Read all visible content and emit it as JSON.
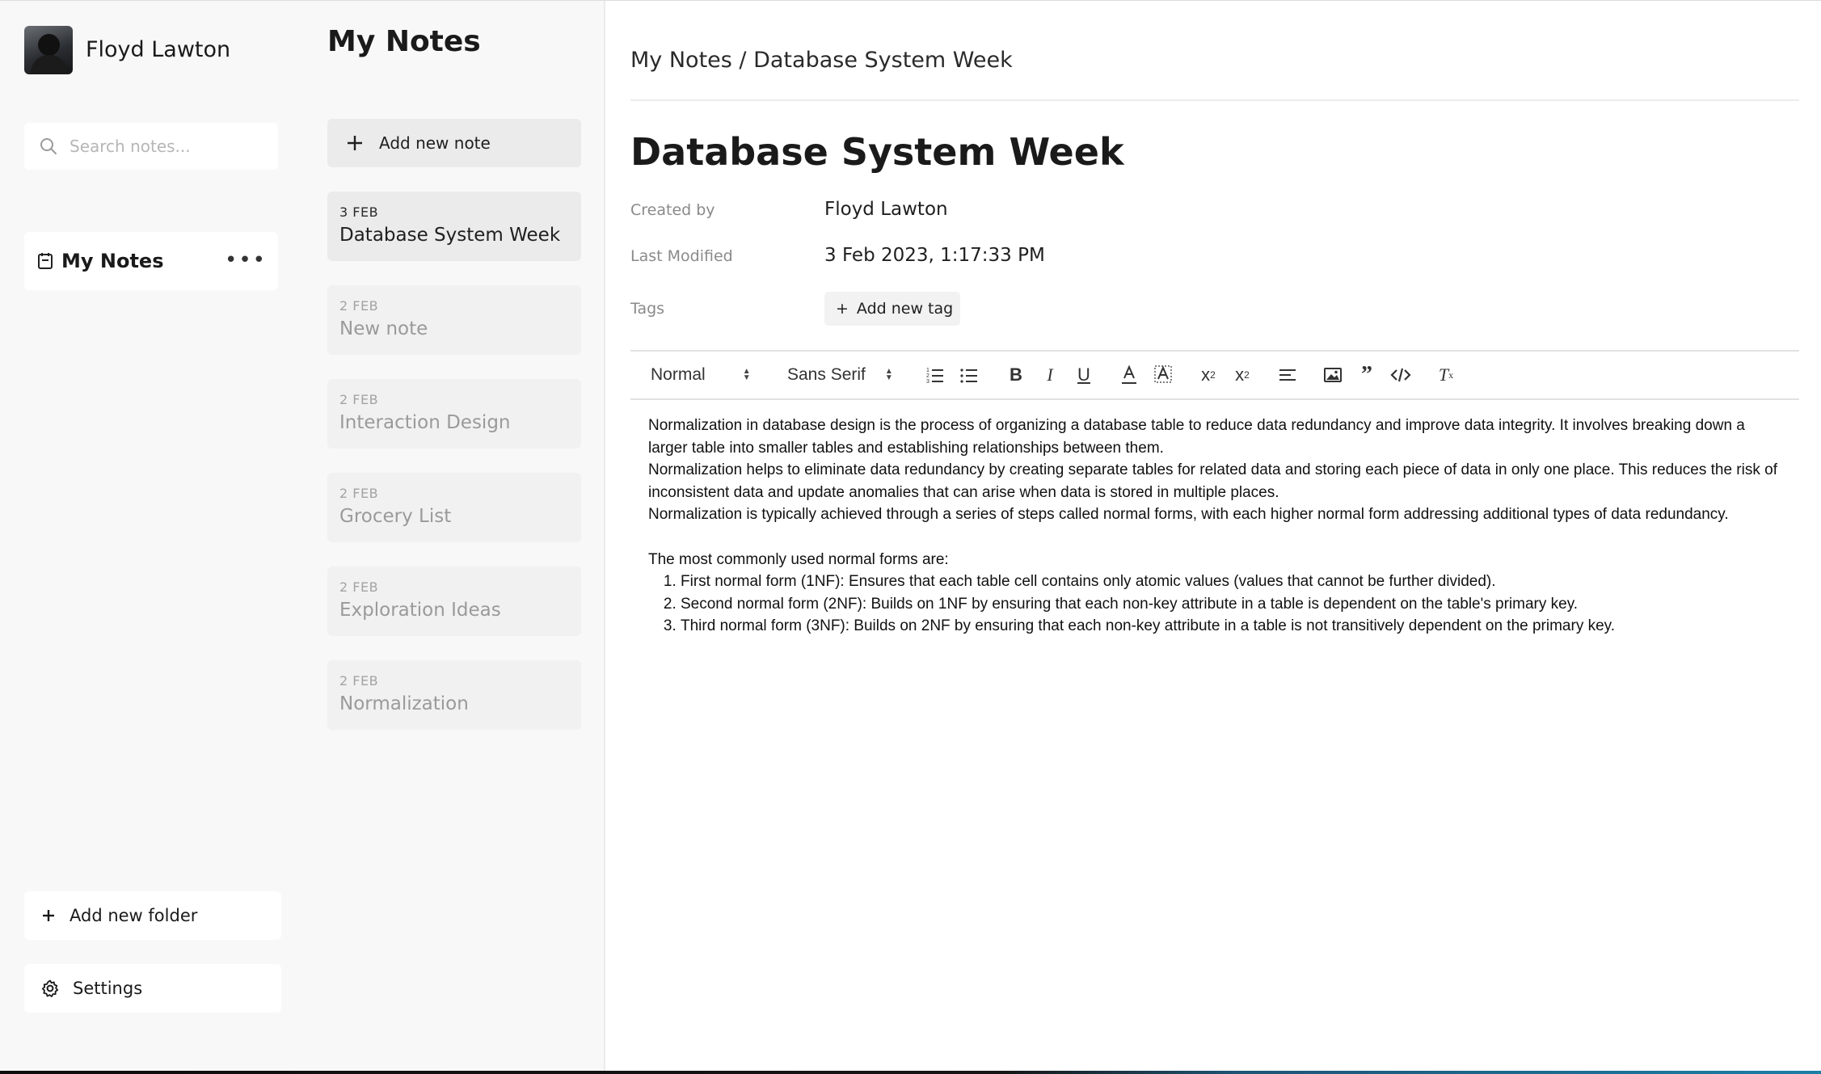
{
  "user": {
    "name": "Floyd Lawton",
    "avatar_icon": "user-avatar"
  },
  "search": {
    "placeholder": "Search notes..."
  },
  "folders": [
    {
      "label": "My Notes",
      "icon": "notebook-icon"
    }
  ],
  "sidebar_actions": {
    "add_folder": "Add new folder",
    "settings": "Settings"
  },
  "notes_panel": {
    "title": "My Notes",
    "add_note": "Add new note",
    "notes": [
      {
        "date": "3 FEB",
        "title": "Database System Week",
        "active": true
      },
      {
        "date": "2 FEB",
        "title": "New note",
        "active": false
      },
      {
        "date": "2 FEB",
        "title": "Interaction Design",
        "active": false
      },
      {
        "date": "2 FEB",
        "title": "Grocery List",
        "active": false
      },
      {
        "date": "2 FEB",
        "title": "Exploration Ideas",
        "active": false
      },
      {
        "date": "2 FEB",
        "title": "Normalization",
        "active": false
      }
    ]
  },
  "document": {
    "breadcrumb": "My Notes / Database System Week",
    "title": "Database System Week",
    "meta": {
      "created_by_label": "Created by",
      "created_by": "Floyd Lawton",
      "modified_label": "Last Modified",
      "modified": "3 Feb 2023, 1:17:33 PM",
      "tags_label": "Tags",
      "add_tag": "Add new tag"
    },
    "toolbar": {
      "heading": "Normal",
      "font": "Sans Serif",
      "icons": [
        "ordered-list-icon",
        "bullet-list-icon",
        "bold-icon",
        "italic-icon",
        "underline-icon",
        "text-color-icon",
        "highlight-icon",
        "subscript-icon",
        "superscript-icon",
        "align-icon",
        "image-icon",
        "blockquote-icon",
        "code-icon",
        "clear-format-icon"
      ]
    },
    "body": {
      "p1": "Normalization in database design is the process of organizing a database table to reduce data redundancy and improve data integrity. It involves breaking down a larger table into smaller tables and establishing relationships between them.",
      "p2": "Normalization helps to eliminate data redundancy by creating separate tables for related data and storing each piece of data in only one place. This reduces the risk of inconsistent data and update anomalies that can arise when data is stored in multiple places.",
      "p3": "Normalization is typically achieved through a series of steps called normal forms, with each higher normal form addressing additional types of data redundancy.",
      "p4": "The most commonly used normal forms are:",
      "list": [
        "First normal form (1NF): Ensures that each table cell contains only atomic values (values that cannot be further divided).",
        "Second normal form (2NF): Builds on 1NF by ensuring that each non-key attribute in a table is dependent on the table's primary key.",
        "Third normal form (3NF): Builds on 2NF by ensuring that each non-key attribute in a table is not transitively dependent on the primary key."
      ]
    }
  }
}
